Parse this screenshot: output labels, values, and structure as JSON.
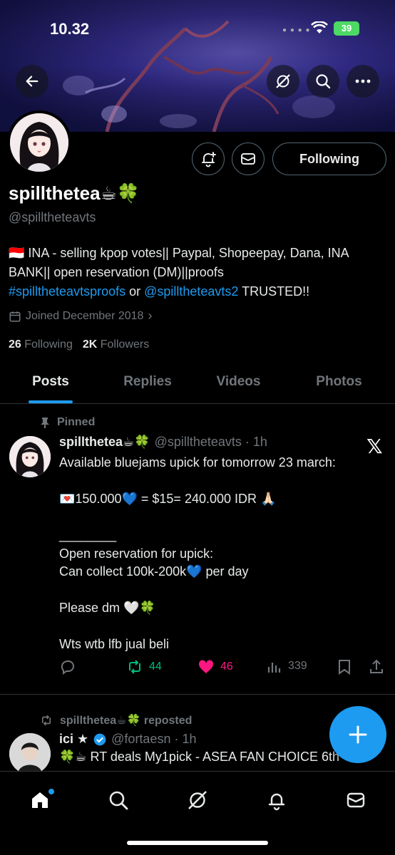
{
  "status_bar": {
    "time": "10.32",
    "battery": "39"
  },
  "profile": {
    "name": "spillthetea☕🍀",
    "handle": "@spilltheteavts",
    "following_button": "Following",
    "bio_line1": "🇮🇩 INA - selling kpop votes|| Paypal, Shopeepay, Dana, INA",
    "bio_line2": "BANK|| open reservation (DM)||proofs",
    "bio_tag": "#spilltheteavtsproofs",
    "bio_or": " or ",
    "bio_mention": "@spilltheteavts2",
    "bio_trusted": " TRUSTED!!",
    "joined": "Joined December 2018",
    "following_count": "26",
    "following_label": "Following",
    "followers_count": "2K",
    "followers_label": "Followers"
  },
  "tabs": [
    "Posts",
    "Replies",
    "Videos",
    "Photos"
  ],
  "pinned_tweet": {
    "pinned_label": "Pinned",
    "author": "spillthetea☕🍀",
    "handle_time": "@spilltheteavts · 1h",
    "body": "Available bluejams upick for tomorrow 23 march:\n\n💌150.000💙 = $15= 240.000 IDR 🙏🏻\n\n________\nOpen reservation for upick:\nCan collect 100k-200k💙 per day\n\nPlease dm 🤍🍀\n\nWts wtb lfb jual beli",
    "retweets": "44",
    "likes": "46",
    "views": "339"
  },
  "second_tweet": {
    "repost_label": "spillthetea☕🍀 reposted",
    "author": "ici ★",
    "handle_time": "@fortaesn · 1h",
    "body": "🍀☕ RT deals  My1pick - ASEA FAN CHOICE 6th"
  },
  "colors": {
    "accent": "#1d9bf0",
    "retweet": "#00ba7c",
    "like": "#f91880"
  }
}
